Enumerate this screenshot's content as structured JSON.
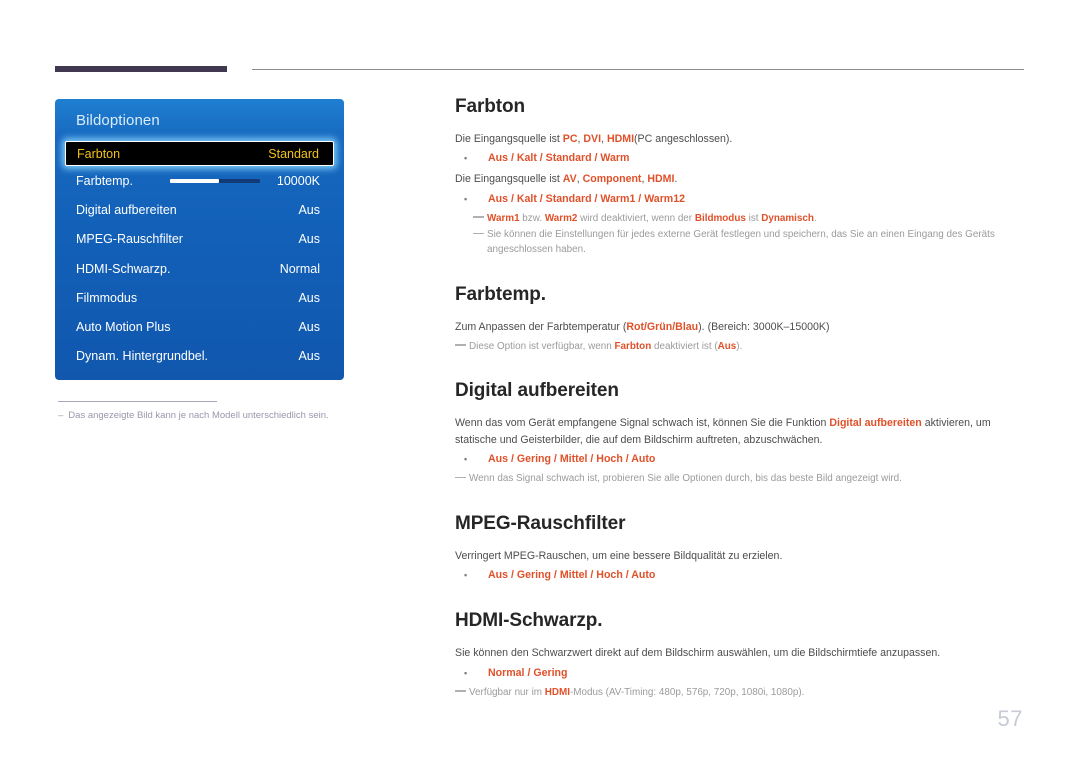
{
  "page": {
    "number": "57"
  },
  "osd": {
    "title": "Bildoptionen",
    "rows": [
      {
        "label": "Farbton",
        "value": "Standard",
        "selected": true,
        "slider": null
      },
      {
        "label": "Farbtemp.",
        "value": "10000K",
        "selected": false,
        "slider": 55
      },
      {
        "label": "Digital aufbereiten",
        "value": "Aus",
        "selected": false,
        "slider": null
      },
      {
        "label": "MPEG-Rauschfilter",
        "value": "Aus",
        "selected": false,
        "slider": null
      },
      {
        "label": "HDMI-Schwarzp.",
        "value": "Normal",
        "selected": false,
        "slider": null
      },
      {
        "label": "Filmmodus",
        "value": "Aus",
        "selected": false,
        "slider": null
      },
      {
        "label": "Auto Motion Plus",
        "value": "Aus",
        "selected": false,
        "slider": null
      },
      {
        "label": "Dynam. Hintergrundbel.",
        "value": "Aus",
        "selected": false,
        "slider": null
      }
    ],
    "note": {
      "dash": "‒",
      "text": "Das angezeigte Bild kann je nach Modell unterschiedlich sein."
    }
  },
  "sections": [
    {
      "title": "Farbton",
      "blocks": [
        {
          "kind": "paragraph",
          "runs": [
            {
              "text": "Die Eingangsquelle ist ",
              "accent": false
            },
            {
              "text": "PC",
              "accent": true
            },
            {
              "text": ", ",
              "accent": false
            },
            {
              "text": "DVI",
              "accent": true
            },
            {
              "text": ", ",
              "accent": false
            },
            {
              "text": "HDMI",
              "accent": true
            },
            {
              "text": "(PC angeschlossen).",
              "accent": false
            }
          ]
        },
        {
          "kind": "option",
          "bullet": "•",
          "text": "Aus / Kalt / Standard / Warm"
        },
        {
          "kind": "paragraph",
          "runs": [
            {
              "text": "Die Eingangsquelle ist ",
              "accent": false
            },
            {
              "text": "AV",
              "accent": true
            },
            {
              "text": ", ",
              "accent": false
            },
            {
              "text": "Component",
              "accent": true
            },
            {
              "text": ", ",
              "accent": false
            },
            {
              "text": "HDMI",
              "accent": true
            },
            {
              "text": ".",
              "accent": false
            }
          ]
        },
        {
          "kind": "option",
          "bullet": "•",
          "text": "Aus / Kalt / Standard / Warm1 / Warm12"
        },
        {
          "kind": "note",
          "indent": true,
          "runs": [
            {
              "text": "Warm1",
              "accent": true
            },
            {
              "text": " bzw. ",
              "accent": false
            },
            {
              "text": "Warm2",
              "accent": true
            },
            {
              "text": " wird deaktiviert, wenn der ",
              "accent": false
            },
            {
              "text": "Bildmodus",
              "accent": true
            },
            {
              "text": " ist ",
              "accent": false
            },
            {
              "text": "Dynamisch",
              "accent": true
            },
            {
              "text": ".",
              "accent": false
            }
          ]
        },
        {
          "kind": "note",
          "indent": true,
          "runs": [
            {
              "text": "Sie können die Einstellungen für jedes externe Gerät festlegen und speichern, das Sie an einen Eingang des Geräts angeschlossen haben.",
              "accent": false
            }
          ]
        }
      ]
    },
    {
      "title": "Farbtemp.",
      "blocks": [
        {
          "kind": "paragraph",
          "runs": [
            {
              "text": "Zum Anpassen der Farbtemperatur (",
              "accent": false
            },
            {
              "text": "Rot/Grün/Blau",
              "accent": true
            },
            {
              "text": "). (Bereich: 3000K–15000K)",
              "accent": false
            }
          ]
        },
        {
          "kind": "note",
          "indent": false,
          "runs": [
            {
              "text": "Diese Option ist verfügbar, wenn ",
              "accent": false
            },
            {
              "text": "Farbton",
              "accent": true
            },
            {
              "text": " deaktiviert ist (",
              "accent": false
            },
            {
              "text": "Aus",
              "accent": true
            },
            {
              "text": ").",
              "accent": false
            }
          ]
        }
      ]
    },
    {
      "title": "Digital aufbereiten",
      "blocks": [
        {
          "kind": "paragraph",
          "runs": [
            {
              "text": "Wenn das vom Gerät empfangene Signal schwach ist, können Sie die Funktion ",
              "accent": false
            },
            {
              "text": "Digital aufbereiten",
              "accent": true
            },
            {
              "text": " aktivieren, um statische und Geisterbilder, die auf dem Bildschirm auftreten, abzuschwächen.",
              "accent": false
            }
          ]
        },
        {
          "kind": "option",
          "bullet": "•",
          "text": "Aus / Gering / Mittel / Hoch / Auto"
        },
        {
          "kind": "note",
          "indent": false,
          "runs": [
            {
              "text": "Wenn das Signal schwach ist, probieren Sie alle Optionen durch, bis das beste Bild angezeigt wird.",
              "accent": false
            }
          ]
        }
      ]
    },
    {
      "title": "MPEG-Rauschfilter",
      "blocks": [
        {
          "kind": "paragraph",
          "runs": [
            {
              "text": "Verringert MPEG-Rauschen, um eine bessere Bildqualität zu erzielen.",
              "accent": false
            }
          ]
        },
        {
          "kind": "option",
          "bullet": "•",
          "text": "Aus / Gering / Mittel / Hoch / Auto"
        }
      ]
    },
    {
      "title": "HDMI-Schwarzp.",
      "blocks": [
        {
          "kind": "paragraph",
          "runs": [
            {
              "text": "Sie können den Schwarzwert direkt auf dem Bildschirm auswählen, um die Bildschirmtiefe anzupassen.",
              "accent": false
            }
          ]
        },
        {
          "kind": "option",
          "bullet": "•",
          "text": "Normal / Gering"
        },
        {
          "kind": "note",
          "indent": false,
          "runs": [
            {
              "text": "Verfügbar nur im ",
              "accent": false
            },
            {
              "text": "HDMI",
              "accent": true
            },
            {
              "text": "-Modus (AV-Timing: 480p, 576p, 720p, 1080i, 1080p).",
              "accent": false
            }
          ]
        }
      ]
    }
  ],
  "colors": {
    "accent": "#e0512a",
    "panel_blue": "#1260b8",
    "selected_text": "#f2c218",
    "rule_purple": "#403850"
  }
}
